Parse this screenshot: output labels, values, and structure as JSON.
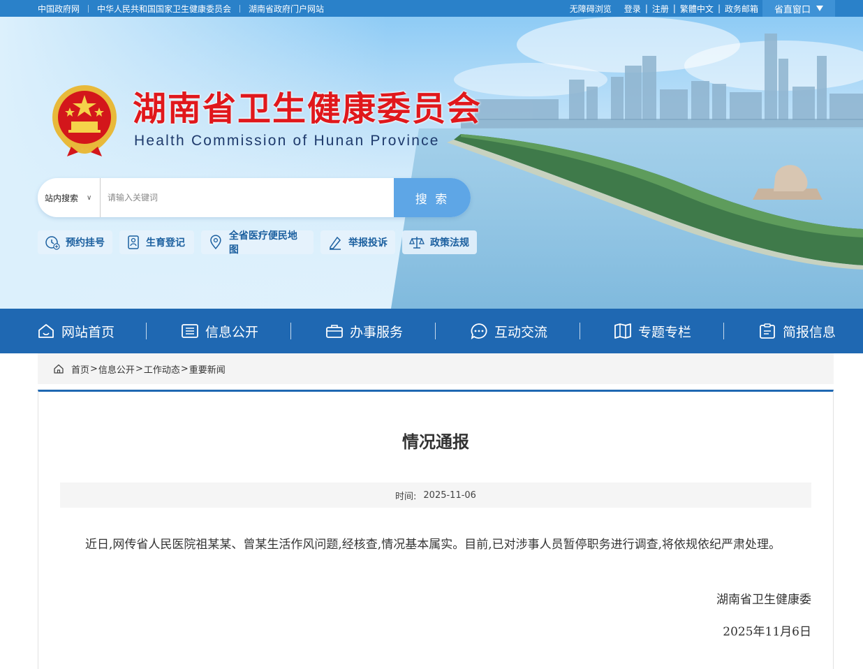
{
  "topbar": {
    "links": [
      "中国政府网",
      "中华人民共和国国家卫生健康委员会",
      "湖南省政府门户网站"
    ],
    "accessibility": "无障碍浏览",
    "login": "登录",
    "register": "注册",
    "traditional": "繁體中文",
    "mail": "政务邮箱",
    "portal": "省直窗口"
  },
  "header": {
    "title": "湖南省卫生健康委员会",
    "subtitle": "Health Commission of Hunan Province"
  },
  "search": {
    "scope": "站内搜索",
    "placeholder": "请输入关键词",
    "button": "搜 索"
  },
  "quick_links": [
    {
      "label": "预约挂号",
      "icon": "appointment-icon"
    },
    {
      "label": "生育登记",
      "icon": "birth-registration-icon"
    },
    {
      "label": "全省医疗便民地图",
      "icon": "map-pin-icon"
    },
    {
      "label": "举报投诉",
      "icon": "report-icon"
    },
    {
      "label": "政策法规",
      "icon": "scale-icon"
    }
  ],
  "nav": [
    {
      "label": "网站首页",
      "icon": "home-icon"
    },
    {
      "label": "信息公开",
      "icon": "list-icon"
    },
    {
      "label": "办事服务",
      "icon": "briefcase-icon"
    },
    {
      "label": "互动交流",
      "icon": "chat-icon"
    },
    {
      "label": "专题专栏",
      "icon": "book-icon"
    },
    {
      "label": "简报信息",
      "icon": "clipboard-icon"
    }
  ],
  "breadcrumb": [
    "首页",
    "信息公开",
    "工作动态",
    "重要新闻"
  ],
  "article": {
    "title": "情况通报",
    "date_label": "时间:",
    "date": "2025-11-06",
    "body": "近日,网传省人民医院祖某某、曾某生活作风问题,经核查,情况基本属实。目前,已对涉事人员暂停职务进行调查,将依规依纪严肃处理。",
    "signature": "湖南省卫生健康委",
    "sign_date": "2025年11月6日"
  },
  "colors": {
    "topbar": "#2a81c9",
    "nav": "#1f68b2",
    "title_red": "#e0181c",
    "search_button": "#5ea6e6"
  }
}
